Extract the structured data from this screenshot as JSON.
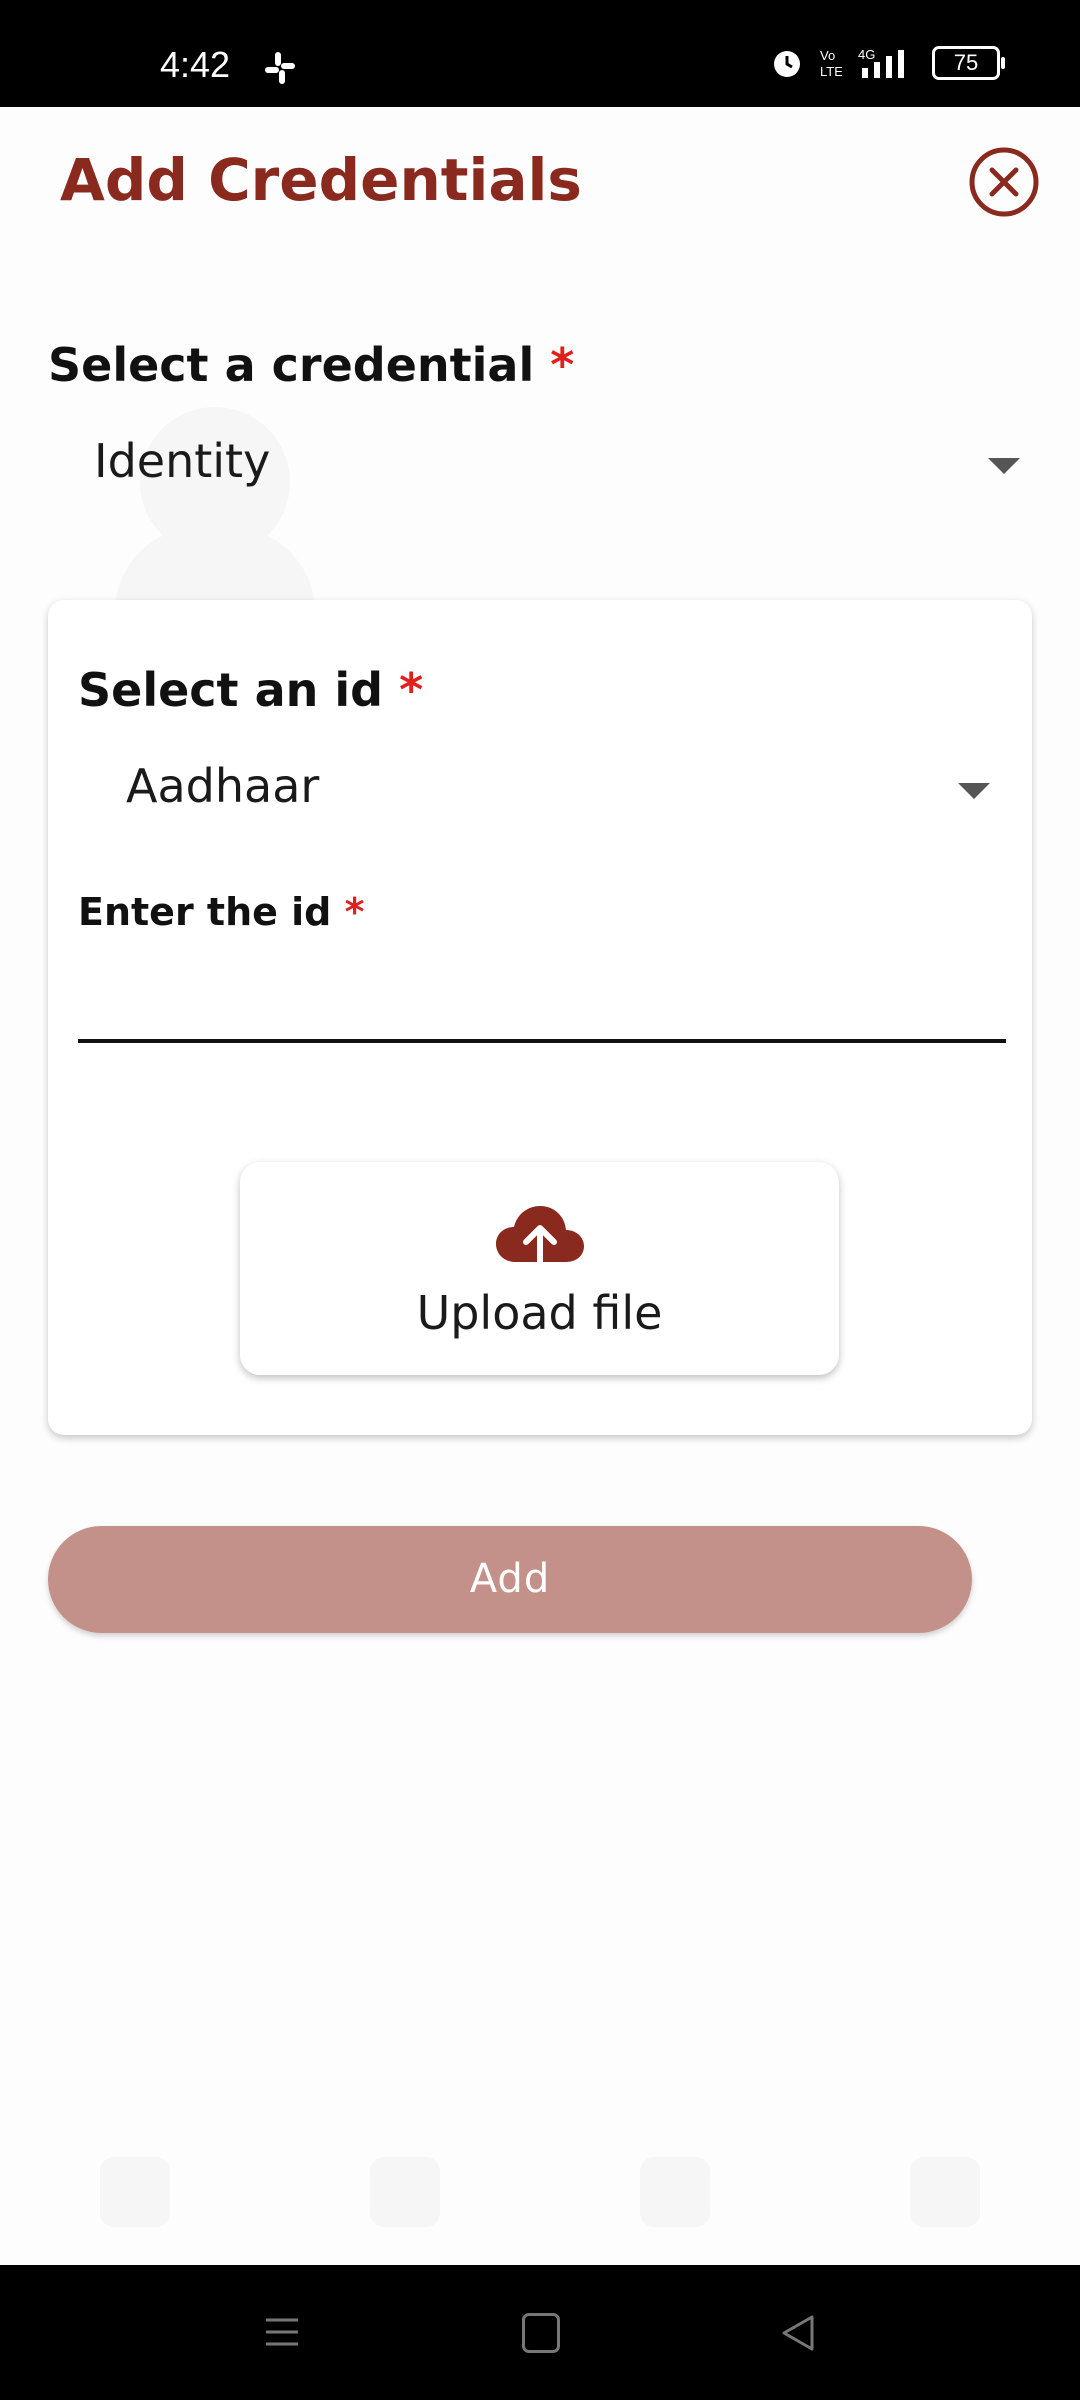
{
  "status_bar": {
    "time": "4:42",
    "battery": "75",
    "icons": [
      "slack-icon",
      "alarm-icon",
      "volte-icon",
      "4g-signal-icon",
      "battery-icon"
    ]
  },
  "modal": {
    "title": "Add Credentials",
    "close_icon": "close-circle-icon",
    "credential_label": "Select a credential",
    "credential_value": "Identity",
    "id_label": "Select an id",
    "id_value": "Aadhaar",
    "enter_id_label": "Enter the id",
    "enter_id_value": "",
    "required_mark": "*",
    "upload_label": "Upload file",
    "upload_icon": "cloud-upload-icon",
    "add_label": "Add"
  },
  "colors": {
    "brand": "#8a2a1f",
    "required": "#e0201a",
    "add_button": "#c4918a"
  },
  "nav_bar": {
    "icons": [
      "menu-icon",
      "home-square-icon",
      "back-triangle-icon"
    ]
  }
}
